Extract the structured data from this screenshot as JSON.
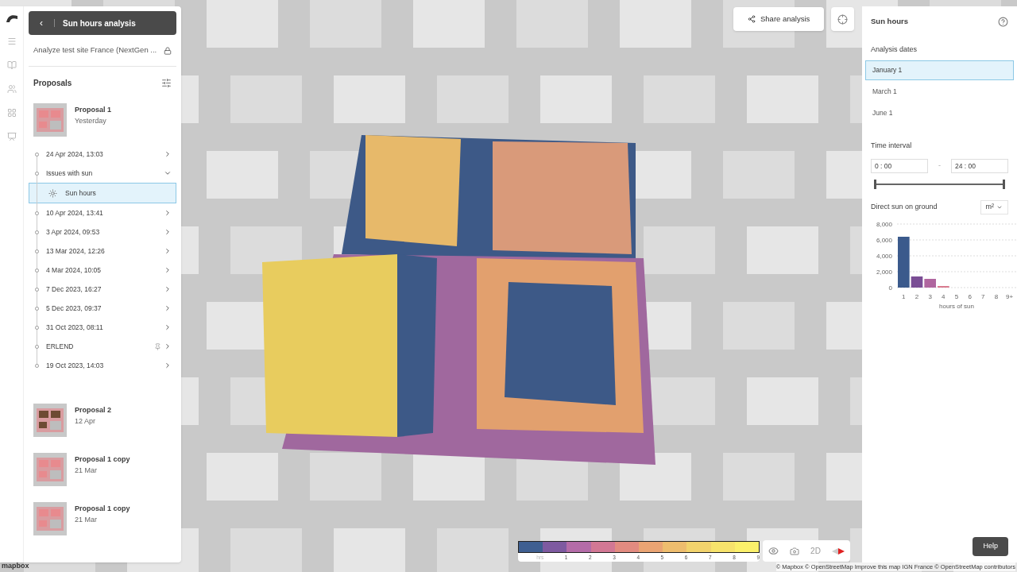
{
  "header": {
    "back": "‹",
    "title": "Sun hours analysis"
  },
  "project": {
    "name": "Analyze test site France (NextGen ..."
  },
  "proposals_heading": "Proposals",
  "proposals": [
    {
      "name": "Proposal 1",
      "date": "Yesterday",
      "timeline": [
        {
          "label": "24 Apr 2024, 13:03",
          "expanded": false,
          "pinned": false
        },
        {
          "label": "Issues with sun",
          "expanded": true,
          "pinned": false,
          "children": [
            {
              "label": "Sun hours",
              "selected": true
            }
          ]
        },
        {
          "label": "10 Apr 2024, 13:41",
          "expanded": false,
          "pinned": false
        },
        {
          "label": "3 Apr 2024, 09:53",
          "expanded": false,
          "pinned": false
        },
        {
          "label": "13 Mar 2024, 12:26",
          "expanded": false,
          "pinned": false
        },
        {
          "label": "4 Mar 2024, 10:05",
          "expanded": false,
          "pinned": false
        },
        {
          "label": "7 Dec 2023, 16:27",
          "expanded": false,
          "pinned": false
        },
        {
          "label": "5 Dec 2023, 09:37",
          "expanded": false,
          "pinned": false
        },
        {
          "label": "31 Oct 2023, 08:11",
          "expanded": false,
          "pinned": false
        },
        {
          "label": "ERLEND",
          "expanded": false,
          "pinned": true
        },
        {
          "label": "19 Oct 2023, 14:03",
          "expanded": false,
          "pinned": false
        }
      ]
    },
    {
      "name": "Proposal 2",
      "date": "12 Apr"
    },
    {
      "name": "Proposal 1 copy",
      "date": "21 Mar"
    },
    {
      "name": "Proposal 1 copy",
      "date": "21 Mar"
    }
  ],
  "share_button": "Share analysis",
  "right_panel": {
    "title": "Sun hours",
    "dates_heading": "Analysis dates",
    "dates": [
      {
        "label": "January 1",
        "selected": true
      },
      {
        "label": "March 1",
        "selected": false
      },
      {
        "label": "June 1",
        "selected": false
      }
    ],
    "interval_heading": "Time interval",
    "start": "0 : 00",
    "separator": "-",
    "end": "24 : 00",
    "range_handles": [
      {
        "level": 0
      },
      {
        "level": 1
      }
    ],
    "sun_heading": "Direct sun on ground",
    "unit": "m²",
    "chart_data": {
      "type": "bar",
      "xlabel": "hours of sun",
      "categories": [
        "1",
        "2",
        "3",
        "4",
        "5",
        "6",
        "7",
        "8",
        "9+"
      ],
      "series": [
        {
          "values": [
            6400,
            1400,
            1100,
            200,
            0,
            0,
            0,
            0,
            0
          ]
        }
      ],
      "grid": true,
      "colors": [
        "#3b5a8c",
        "#7a4e95",
        "#b0669f",
        "#d97c8f",
        "#e49379",
        "#eab06a",
        "#efc668",
        "#f4da6a",
        "#f7ea6b"
      ],
      "ylim": [
        0,
        8000
      ],
      "yticks": [
        {
          "value": 0,
          "label": "0"
        },
        {
          "value": 2000,
          "label": "2,000"
        },
        {
          "value": 4000,
          "label": "4,000"
        },
        {
          "value": 6000,
          "label": "6,000"
        },
        {
          "value": 8000,
          "label": "8,000"
        }
      ]
    }
  },
  "legend": {
    "unit": "hrs",
    "labels": [
      "1",
      "2",
      "3",
      "4",
      "5",
      "6",
      "7",
      "8",
      "9"
    ],
    "swatches": [
      {
        "color": "#3f5f91"
      },
      {
        "color": "#7e5aa0"
      },
      {
        "color": "#b46ca8"
      },
      {
        "color": "#d27894"
      },
      {
        "color": "#e28b80"
      },
      {
        "color": "#eaa473"
      },
      {
        "color": "#eebd6e"
      },
      {
        "color": "#f2d36d"
      },
      {
        "color": "#f7e36c"
      },
      {
        "color": "#fbf06b"
      }
    ]
  },
  "view_controls": {
    "mode": "2D"
  },
  "help": "Help",
  "attribution": "© Mapbox © OpenStreetMap Improve this map IGN France © OpenStreetMap contributors",
  "map_logo": "mapbox"
}
